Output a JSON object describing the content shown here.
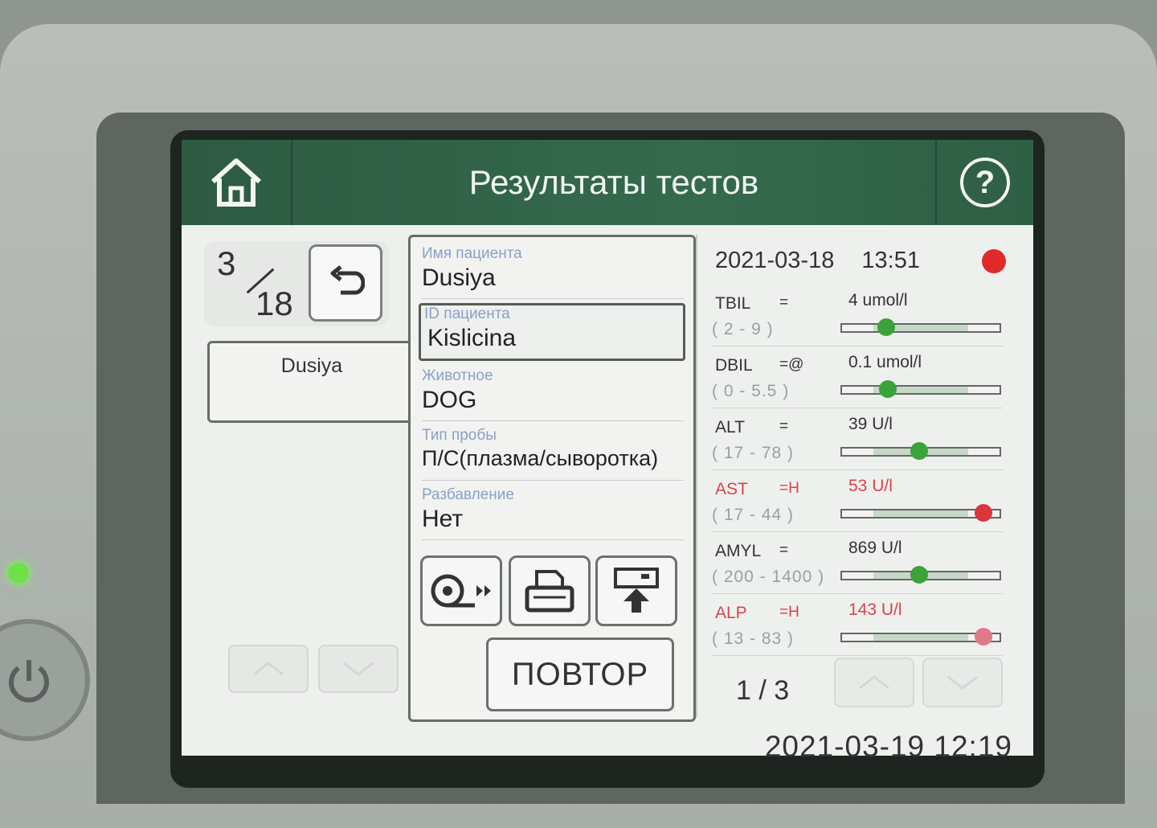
{
  "header": {
    "title": "Результаты тестов",
    "home_icon": "home-icon",
    "help_icon": "help-icon",
    "help_glyph": "?"
  },
  "record_counter": {
    "current": "3",
    "total": "18"
  },
  "patient_tab": {
    "label": "Dusiya"
  },
  "patient_info": {
    "name_label": "Имя пациента",
    "name_value": "Dusiya",
    "id_label": "ID пациента",
    "id_value": "Kislicina",
    "animal_label": "Животное",
    "animal_value": "DOG",
    "sample_label": "Тип пробы",
    "sample_value": "П/С(плазма/сыворотка)",
    "dilution_label": "Разбавление",
    "dilution_value": "Нет"
  },
  "actions": {
    "feed_icon": "paper-feed-icon",
    "print_icon": "printer-icon",
    "export_icon": "export-icon",
    "repeat_label": "ПОВТОР"
  },
  "results": {
    "date": "2021-03-18",
    "time": "13:51",
    "status_color": "#e02a2a",
    "page": "1 / 3",
    "rows": [
      {
        "name": "TBIL",
        "flag": "=",
        "value": "4 umol/l",
        "range": "(   2 -    9 )",
        "level": 0.28,
        "marker_color": "#3aa33a",
        "abnormal": false
      },
      {
        "name": "DBIL",
        "flag": "=@",
        "value": "0.1 umol/l",
        "range": "(   0 -  5.5 )",
        "level": 0.29,
        "marker_color": "#3aa33a",
        "abnormal": false
      },
      {
        "name": "ALT",
        "flag": "=",
        "value": "39 U/l",
        "range": "(  17 -   78 )",
        "level": 0.49,
        "marker_color": "#3aa33a",
        "abnormal": false
      },
      {
        "name": "AST",
        "flag": "=H",
        "value": "53 U/l",
        "range": "(  17 -   44 )",
        "level": 0.9,
        "marker_color": "#d9363e",
        "abnormal": true
      },
      {
        "name": "AMYL",
        "flag": "=",
        "value": "869 U/l",
        "range": "( 200 - 1400 )",
        "level": 0.49,
        "marker_color": "#3aa33a",
        "abnormal": false
      },
      {
        "name": "ALP",
        "flag": "=H",
        "value": "143 U/l",
        "range": "(  13 -   83 )",
        "level": 0.9,
        "marker_color": "#e07a8a",
        "abnormal": true
      }
    ]
  },
  "footer": {
    "clock": "2021-03-19 12:19"
  },
  "colors": {
    "accent": "#2d5a42",
    "normal_marker": "#3aa33a",
    "high_marker": "#d9363e"
  }
}
